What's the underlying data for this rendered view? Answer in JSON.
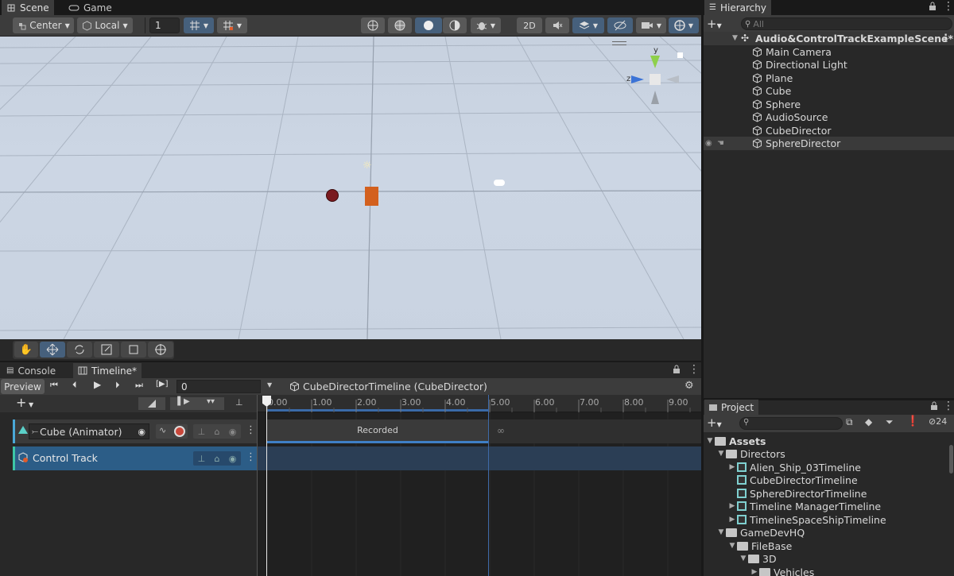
{
  "scene_tabs": {
    "scene": "Scene",
    "game": "Game"
  },
  "scene_toolbar": {
    "pivot": "Center",
    "space": "Local",
    "grid_snap": "1",
    "mode_2d": "2D"
  },
  "hierarchy": {
    "title": "Hierarchy",
    "search_placeholder": "All",
    "scene_name": "Audio&ControlTrackExampleScene*",
    "items": [
      "Main Camera",
      "Directional Light",
      "Plane",
      "Cube",
      "Sphere",
      "AudioSource",
      "CubeDirector",
      "SphereDirector"
    ]
  },
  "gizmo": {
    "y": "y",
    "z": "z"
  },
  "bottom_tabs": {
    "console": "Console",
    "timeline": "Timeline*"
  },
  "timeline": {
    "preview": "Preview",
    "frame": "0",
    "asset": "CubeDirectorTimeline (CubeDirector)",
    "ruler": [
      "0.00",
      "1.00",
      "2.00",
      "3.00",
      "4.00",
      "5.00",
      "6.00",
      "7.00",
      "8.00",
      "9.00"
    ],
    "tracks": [
      {
        "name": "Cube (Animator)"
      },
      {
        "name": "Control Track"
      }
    ],
    "clip_label": "Recorded",
    "colors": {
      "selected_track": "#2c5d87",
      "accent": "#46607c"
    }
  },
  "project": {
    "title": "Project",
    "hidden_count": "24",
    "items": [
      {
        "label": "Assets"
      },
      {
        "label": "Directors"
      },
      {
        "label": "Alien_Ship_03Timeline"
      },
      {
        "label": "CubeDirectorTimeline"
      },
      {
        "label": "SphereDirectorTimeline"
      },
      {
        "label": "Timeline ManagerTimeline"
      },
      {
        "label": "TimelineSpaceShipTimeline"
      },
      {
        "label": "GameDevHQ"
      },
      {
        "label": "FileBase"
      },
      {
        "label": "3D"
      },
      {
        "label": "Vehicles"
      }
    ]
  }
}
